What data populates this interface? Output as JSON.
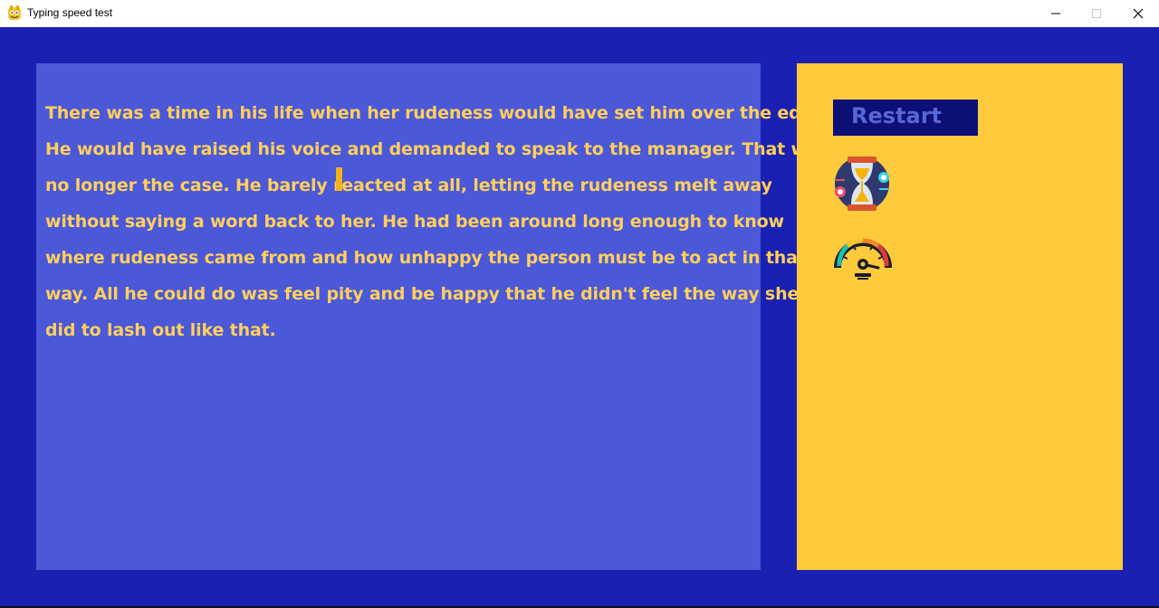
{
  "window": {
    "title": "Typing speed test",
    "controls": {
      "minimize": "minimize-icon",
      "maximize": "maximize-icon",
      "close": "close-icon"
    }
  },
  "passage": {
    "lines": [
      "There was a time in his life when her rudeness would have set him over the edge.",
      "He would have raised his voice and demanded to speak to the manager. That was",
      "no longer the case. He barely reacted at all, letting the rudeness melt away",
      "without saying a word back to her. He had been around long enough to know",
      "where rudeness came from and how unhappy the person must be to act in that",
      "way. All he could do was feel pity and be happy that he didn't feel the way she",
      "did to lash out like that."
    ]
  },
  "sidebar": {
    "restart_label": "Restart",
    "icons": [
      "hourglass-icon",
      "speedometer-icon"
    ]
  },
  "colors": {
    "background": "#1a20b2",
    "text_panel": "#4b58d8",
    "passage_text": "#ffcf5d",
    "cursor": "#f3b21c",
    "side_panel": "#ffca3c",
    "restart_bg": "#0c1076",
    "restart_text": "#5866d6"
  }
}
